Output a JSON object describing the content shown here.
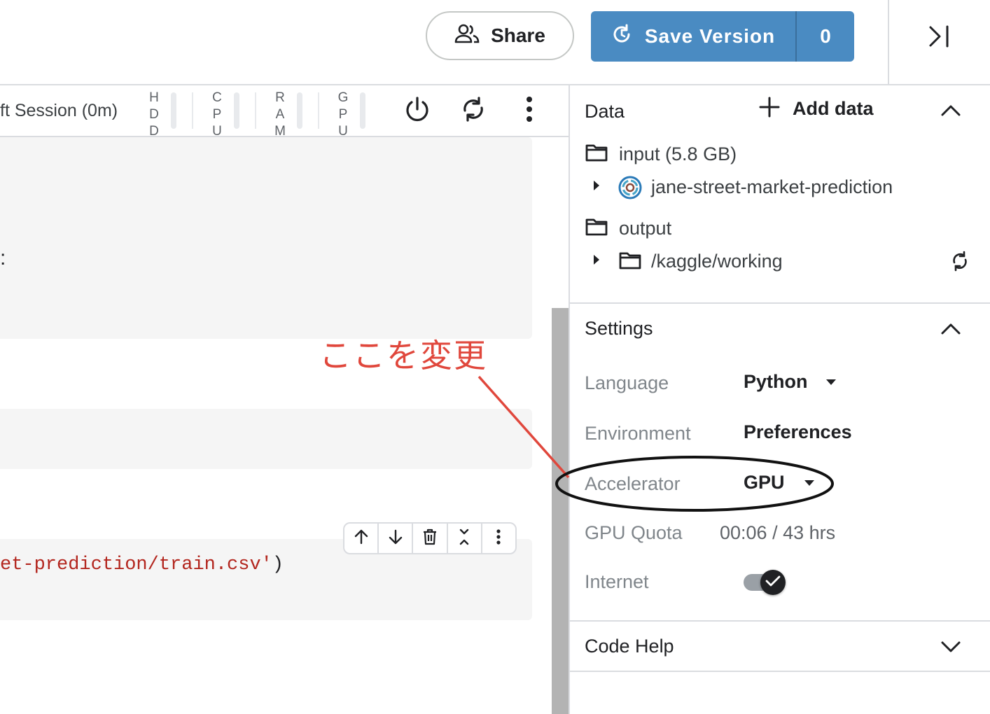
{
  "header": {
    "share_label": "Share",
    "save_version_label": "Save Version",
    "save_version_count": "0"
  },
  "session": {
    "label": "ft Session (0m)",
    "meters": [
      "HDD",
      "CPU",
      "RAM",
      "GPU"
    ]
  },
  "notebook": {
    "code_path": "et-prediction/train.csv'",
    "code_close_paren": ")",
    "colon_fragment": ":"
  },
  "annotation": {
    "text": "ここを変更",
    "color": "#e0473c"
  },
  "data_panel": {
    "title": "Data",
    "add_data_label": "Add data",
    "input_folder": "input (5.8 GB)",
    "dataset_name": "jane-street-market-prediction",
    "output_folder": "output",
    "working_dir": "/kaggle/working"
  },
  "settings": {
    "title": "Settings",
    "language_label": "Language",
    "language_value": "Python",
    "environment_label": "Environment",
    "environment_value": "Preferences",
    "accelerator_label": "Accelerator",
    "accelerator_value": "GPU",
    "gpu_quota_label": "GPU Quota",
    "gpu_quota_value": "00:06 / 43 hrs",
    "internet_label": "Internet",
    "internet_enabled": true
  },
  "code_help": {
    "title": "Code Help"
  },
  "colors": {
    "accent": "#4a8bc2",
    "annotation": "#e0473c"
  }
}
